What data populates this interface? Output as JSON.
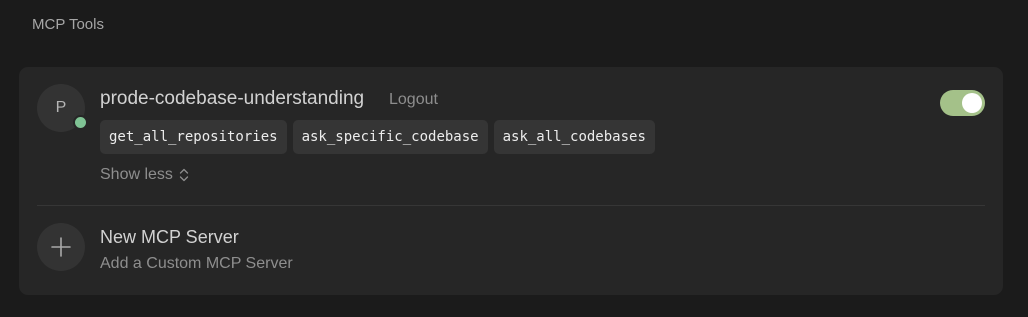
{
  "section_title": "MCP Tools",
  "server": {
    "avatar_letter": "P",
    "name": "prode-codebase-understanding",
    "logout_label": "Logout",
    "enabled": true,
    "status_color": "#7fc394",
    "tools": [
      "get_all_repositories",
      "ask_specific_codebase",
      "ask_all_codebases"
    ],
    "show_less_label": "Show less"
  },
  "new_server": {
    "title": "New MCP Server",
    "subtitle": "Add a Custom MCP Server",
    "icon": "plus-icon"
  },
  "colors": {
    "toggle_on": "#a4c189",
    "background": "#1b1b1b",
    "card": "#262626"
  }
}
